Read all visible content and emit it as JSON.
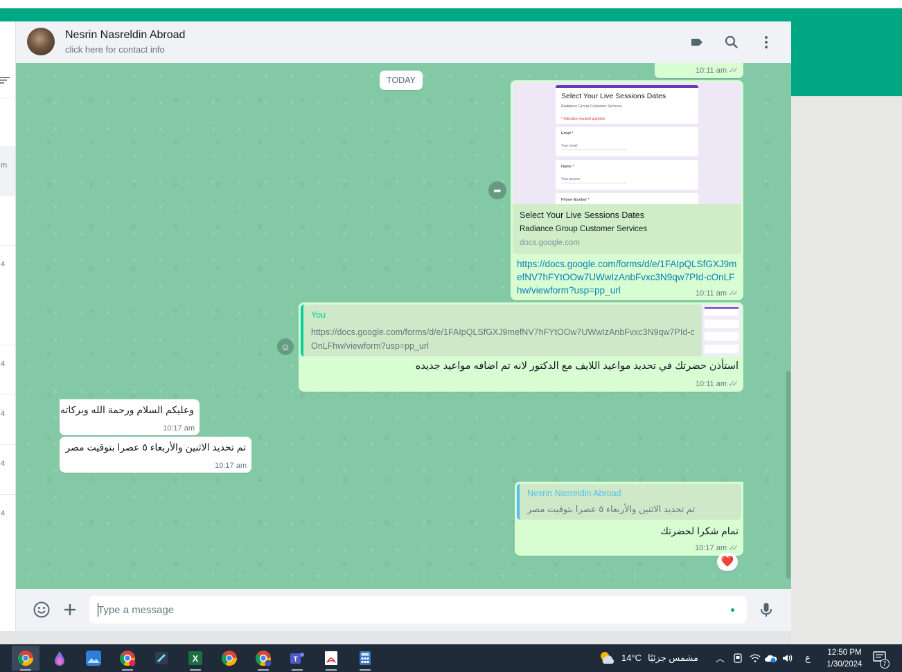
{
  "header": {
    "contact_name": "Nesrin Nasreldin Abroad",
    "contact_sub": "click here for contact info"
  },
  "left_panel": {
    "cut_labels": [
      "m",
      "4",
      "4",
      "4",
      "4",
      "4"
    ]
  },
  "messages": {
    "date_chip": "TODAY",
    "prev": {
      "time": "10:11 am"
    },
    "link_message": {
      "preview_form_title": "Select Your Live Sessions Dates",
      "preview_form_subtitle": "Radiance Group Customer Services",
      "preview_required": "* Indicates required question",
      "preview_fields": [
        {
          "label": "Email *",
          "placeholder": "Your email"
        },
        {
          "label": "Name *",
          "placeholder": "Your answer"
        },
        {
          "label": "Phone Number *",
          "placeholder": ""
        }
      ],
      "title": "Select Your Live Sessions Dates",
      "description": "Radiance Group Customer Services",
      "domain": "docs.google.com",
      "url": "https://docs.google.com/forms/d/e/1FAIpQLSfGXJ9mefNV7hFYtOOw7UWwIzAnbFvxc3N9qw7PId-cOnLFhw/viewform?usp=pp_url",
      "time": "10:11 am"
    },
    "reply_message": {
      "quote_author": "You",
      "quote_text": "https://docs.google.com/forms/d/e/1FAIpQLSfGXJ9mefNV7hFYtOOw7UWwIzAnbFvxc3N9qw7PId-cOnLFhw/viewform?usp=pp_url",
      "body": "استأذن حضرتك في تحديد مواعيد اللايف مع الدكتور لانه تم اضافه مواعيد جديده",
      "time": "10:11 am"
    },
    "incoming": [
      {
        "text": "وعليكم السلام ورحمة الله وبركاته",
        "time": "10:17 am"
      },
      {
        "text": "تم تحديد الاثنين والأربعاء ٥ عصرا بتوقيت مصر",
        "time": "10:17 am"
      }
    ],
    "reply_message_2": {
      "quote_author": "Nesrin Nasreldin Abroad",
      "quote_text": "تم تحديد الاثنين والأربعاء ٥ عصرا بتوقيت مصر",
      "body": "تمام شكرا لحضرتك",
      "time": "10:17 am",
      "reaction": "❤️"
    }
  },
  "composer": {
    "placeholder": "Type a message"
  },
  "taskbar": {
    "weather_temp": "14°C",
    "weather_desc": "مشمس جزئيًا",
    "lang": "ع",
    "time": "12:50 PM",
    "date": "1/30/2024",
    "notif_count": "7"
  },
  "colors": {
    "accent": "#00a884",
    "outgoing_bubble": "#d9fdd3",
    "chat_bg": "#84c9a6",
    "link": "#027eb5"
  }
}
